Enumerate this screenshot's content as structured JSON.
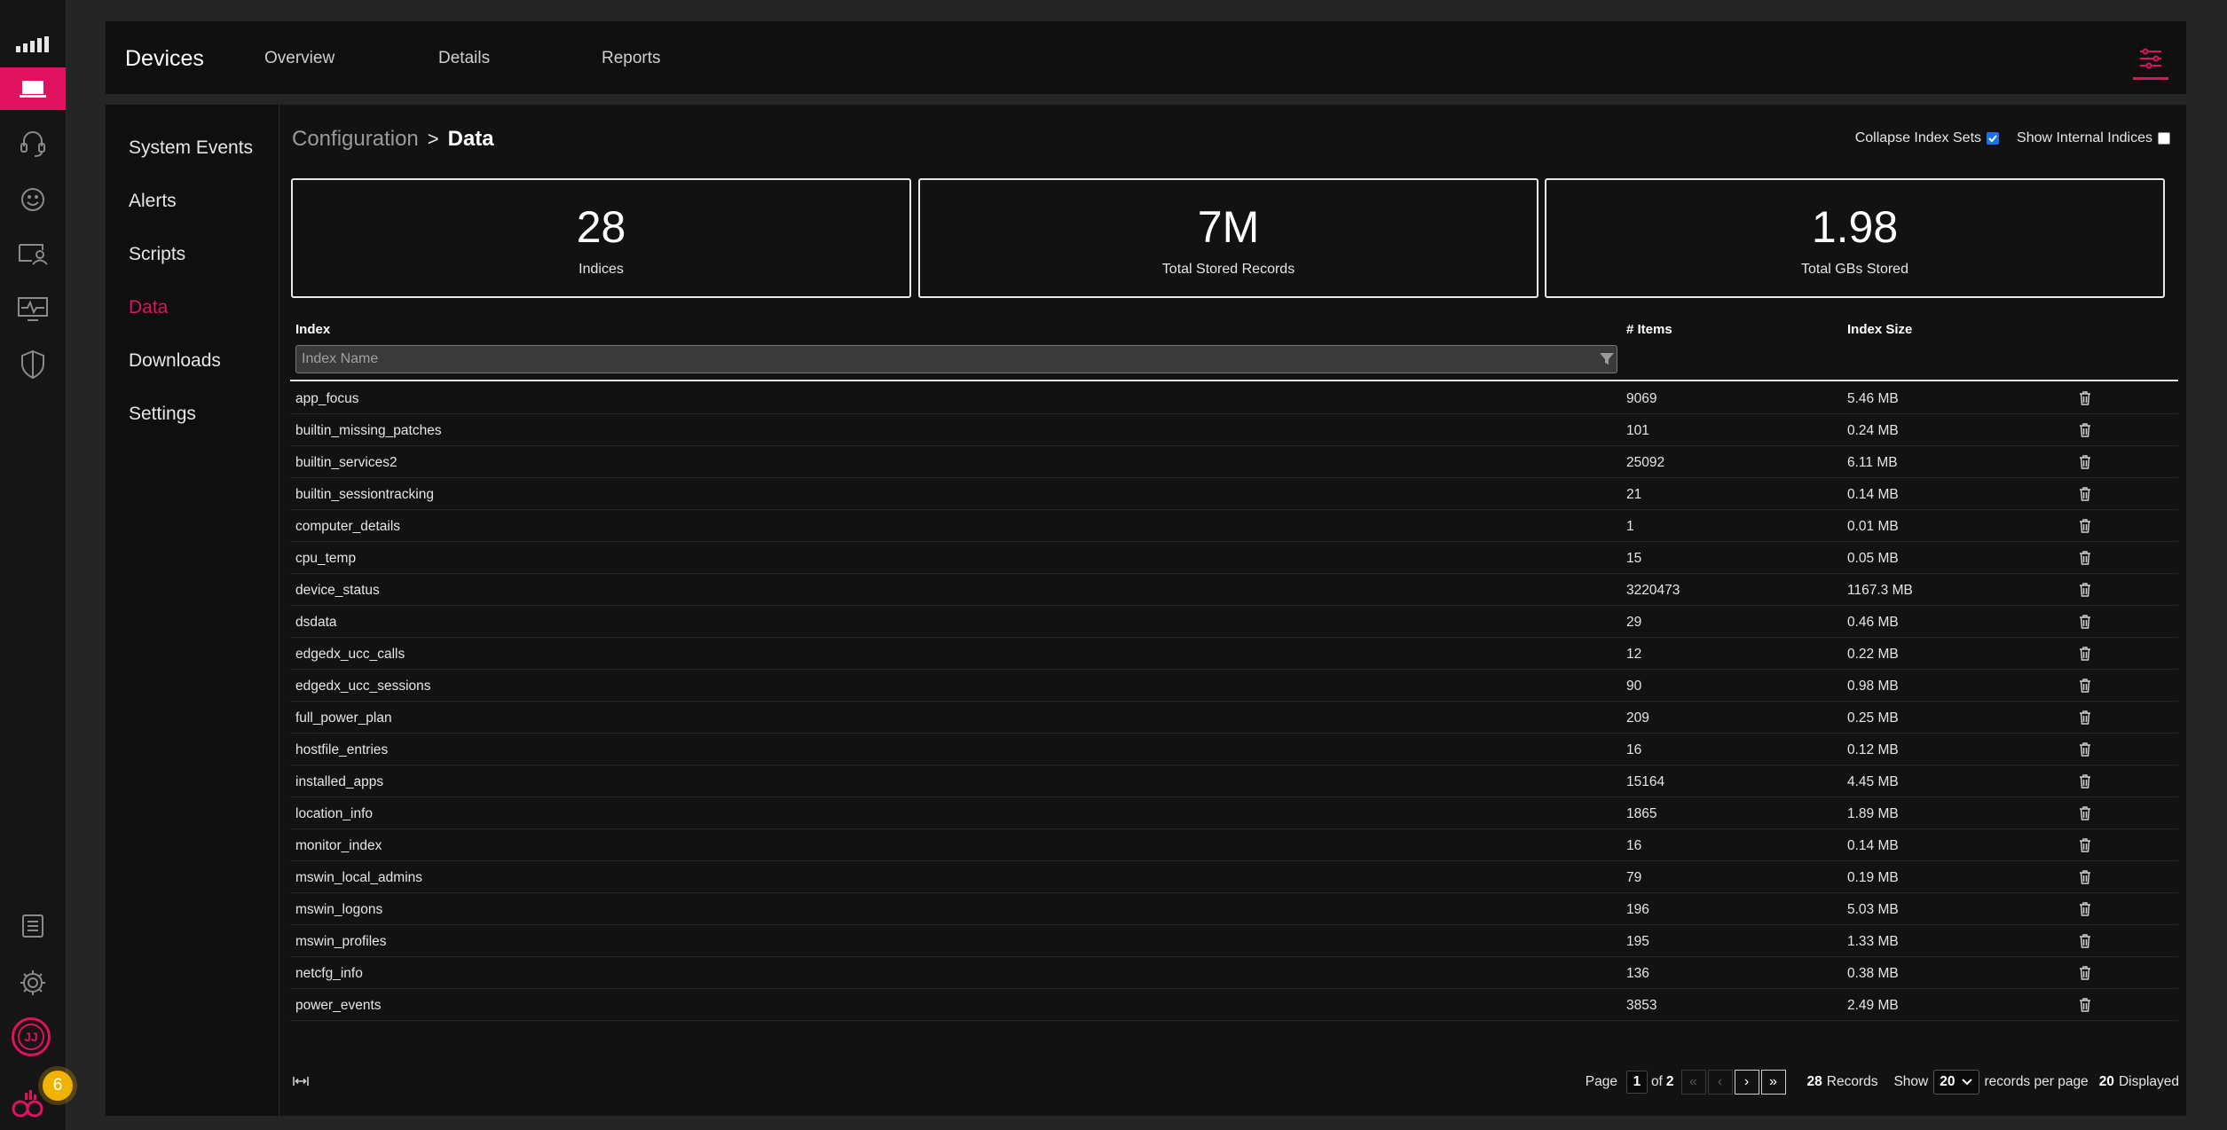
{
  "header": {
    "app_title": "Devices",
    "tabs": [
      {
        "label": "Overview"
      },
      {
        "label": "Details"
      },
      {
        "label": "Reports"
      }
    ]
  },
  "sidebar": {
    "items": [
      {
        "label": "System Events"
      },
      {
        "label": "Alerts"
      },
      {
        "label": "Scripts"
      },
      {
        "label": "Data",
        "active": true
      },
      {
        "label": "Downloads"
      },
      {
        "label": "Settings"
      }
    ]
  },
  "rail": {
    "icons": [
      "signal-bars-icon",
      "laptop-icon",
      "headset-icon",
      "smiley-icon",
      "user-card-icon",
      "monitor-activity-icon",
      "shield-icon",
      "report-list-icon",
      "gear-icon"
    ],
    "avatar_initials": "JJ",
    "notification_count": "6"
  },
  "breadcrumb": {
    "parent": "Configuration",
    "separator": ">",
    "current": "Data"
  },
  "options": {
    "collapse_label": "Collapse Index Sets",
    "collapse_checked": true,
    "internal_label": "Show Internal Indices",
    "internal_checked": false
  },
  "stats": [
    {
      "value": "28",
      "label": "Indices"
    },
    {
      "value": "7M",
      "label": "Total Stored Records"
    },
    {
      "value": "1.98",
      "label": "Total GBs Stored"
    }
  ],
  "table": {
    "columns": [
      "Index",
      "# Items",
      "Index Size"
    ],
    "filter_placeholder": "Index Name",
    "rows": [
      {
        "name": "app_focus",
        "items": "9069",
        "size": "5.46 MB"
      },
      {
        "name": "builtin_missing_patches",
        "items": "101",
        "size": "0.24 MB"
      },
      {
        "name": "builtin_services2",
        "items": "25092",
        "size": "6.11 MB"
      },
      {
        "name": "builtin_sessiontracking",
        "items": "21",
        "size": "0.14 MB"
      },
      {
        "name": "computer_details",
        "items": "1",
        "size": "0.01 MB"
      },
      {
        "name": "cpu_temp",
        "items": "15",
        "size": "0.05 MB"
      },
      {
        "name": "device_status",
        "items": "3220473",
        "size": "1167.3 MB"
      },
      {
        "name": "dsdata",
        "items": "29",
        "size": "0.46 MB"
      },
      {
        "name": "edgedx_ucc_calls",
        "items": "12",
        "size": "0.22 MB"
      },
      {
        "name": "edgedx_ucc_sessions",
        "items": "90",
        "size": "0.98 MB"
      },
      {
        "name": "full_power_plan",
        "items": "209",
        "size": "0.25 MB"
      },
      {
        "name": "hostfile_entries",
        "items": "16",
        "size": "0.12 MB"
      },
      {
        "name": "installed_apps",
        "items": "15164",
        "size": "4.45 MB"
      },
      {
        "name": "location_info",
        "items": "1865",
        "size": "1.89 MB"
      },
      {
        "name": "monitor_index",
        "items": "16",
        "size": "0.14 MB"
      },
      {
        "name": "mswin_local_admins",
        "items": "79",
        "size": "0.19 MB"
      },
      {
        "name": "mswin_logons",
        "items": "196",
        "size": "5.03 MB"
      },
      {
        "name": "mswin_profiles",
        "items": "195",
        "size": "1.33 MB"
      },
      {
        "name": "netcfg_info",
        "items": "136",
        "size": "0.38 MB"
      },
      {
        "name": "power_events",
        "items": "3853",
        "size": "2.49 MB"
      }
    ]
  },
  "pagination": {
    "page_label": "Page",
    "page": "1",
    "of_label": "of",
    "total_pages": "2",
    "records_count": "28",
    "records_label": "Records",
    "show_label": "Show",
    "per_page": "20",
    "per_page_label": "records per page",
    "displayed_count": "20",
    "displayed_label": "Displayed"
  },
  "colors": {
    "accent": "#e0115f",
    "background": "#252525",
    "panel": "#0f0f0f",
    "checkbox_checked": "#1a73e8",
    "badge": "#f0b400"
  }
}
